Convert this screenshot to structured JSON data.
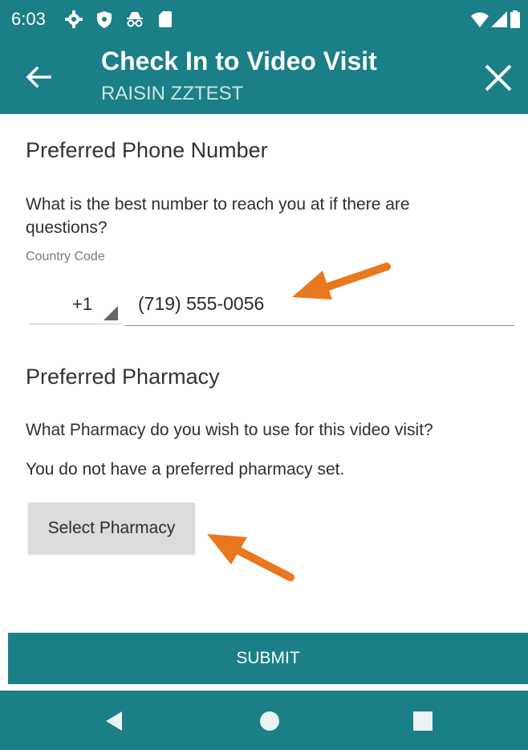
{
  "status_bar": {
    "time": "6:03",
    "icons": [
      "settings-gear-icon",
      "shield-icon",
      "incognito-icon",
      "sd-card-icon",
      "wifi-icon",
      "signal-icon",
      "battery-icon"
    ]
  },
  "header": {
    "title": "Check In to Video Visit",
    "subtitle": "RAISIN ZZTEST",
    "back_icon": "arrow-left-icon",
    "close_icon": "close-icon"
  },
  "phone_section": {
    "heading": "Preferred Phone Number",
    "question": "What is the best number to reach you at if there are questions?",
    "country_code_label": "Country Code",
    "country_code_value": "+1",
    "phone_value": "(719) 555-0056"
  },
  "pharmacy_section": {
    "heading": "Preferred Pharmacy",
    "question": "What Pharmacy do you wish to use for this video visit?",
    "status_text": "You do not have a preferred pharmacy set.",
    "select_button_label": "Select Pharmacy"
  },
  "footer": {
    "submit_label": "SUBMIT"
  },
  "nav_bar": {
    "icons": [
      "nav-back-icon",
      "nav-home-icon",
      "nav-recents-icon"
    ]
  },
  "colors": {
    "primary": "#1a7f86",
    "annotation_arrow": "#e8771e",
    "button_gray": "#dcdcdc"
  }
}
